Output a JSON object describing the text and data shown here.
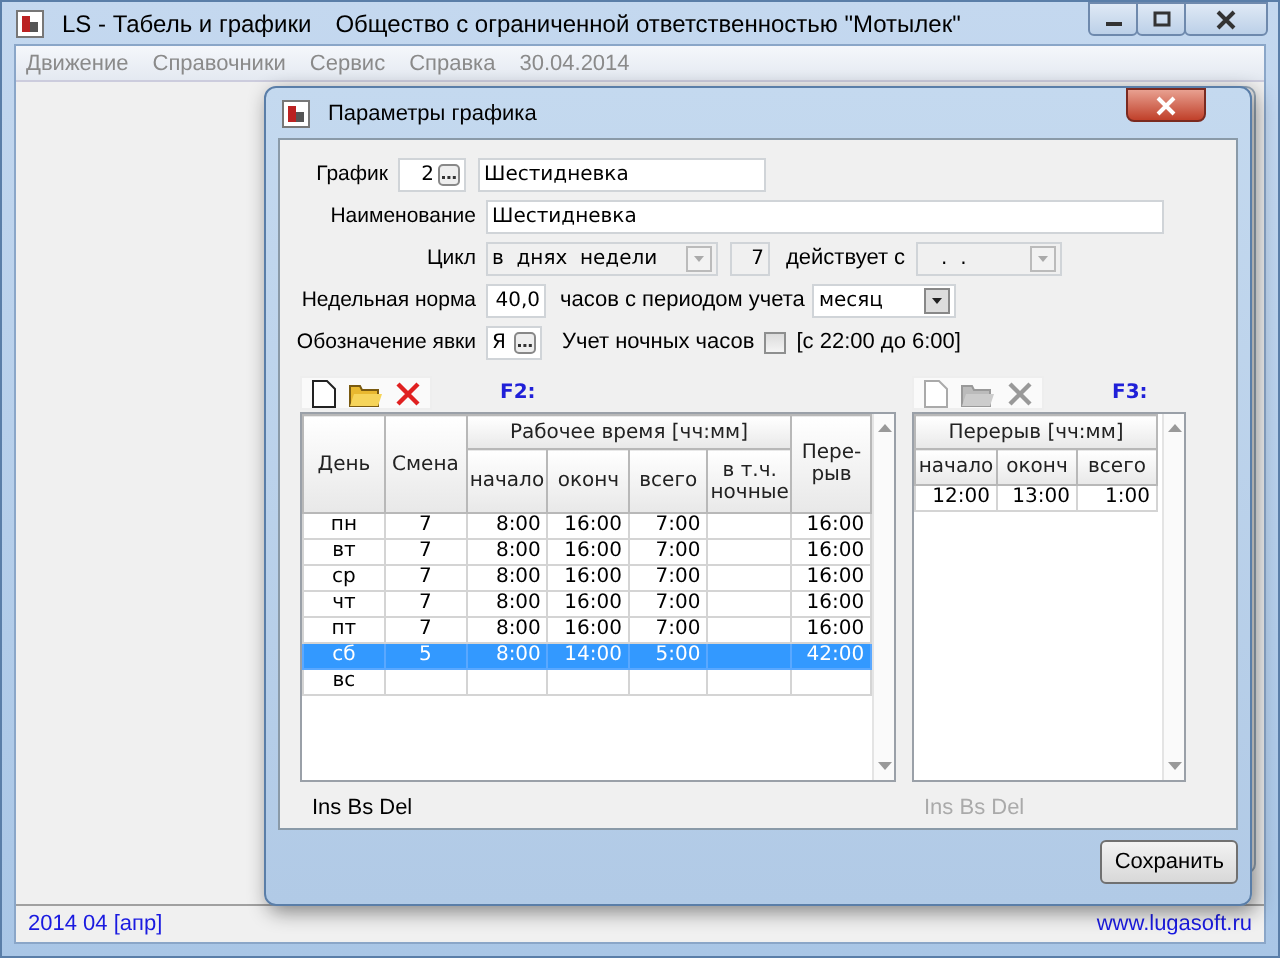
{
  "window": {
    "title": "LS - Табель и графики",
    "company": "Общество с ограниченной ответственностью \"Мотылек\""
  },
  "menu": [
    {
      "label": "Движение",
      "disabled": true
    },
    {
      "label": "Справочники",
      "disabled": true
    },
    {
      "label": "Сервис",
      "disabled": true
    },
    {
      "label": "Справка",
      "disabled": true
    },
    {
      "label": "30.04.2014",
      "disabled": true
    }
  ],
  "dialog": {
    "title": "Параметры графика",
    "schedule": {
      "label": "График",
      "number": "2",
      "name": "Шестидневка"
    },
    "name_field": {
      "label": "Наименование",
      "value": "Шестидневка"
    },
    "cycle": {
      "label": "Цикл",
      "type": "в  днях  недели",
      "type_disabled": true,
      "length": "7",
      "effective_label": "действует с",
      "effective_value": ".  .",
      "effective_disabled": true
    },
    "norm": {
      "label": "Недельная норма",
      "value": "40,0",
      "period_label": "часов с периодом учета",
      "period": "месяц",
      "period_disabled": false
    },
    "attendance": {
      "label": "Обозначение явки",
      "value": "Я",
      "night_label": "Учет ночных часов",
      "night_checked": false,
      "night_range": "[с 22:00 до 6:00]"
    },
    "work_table": {
      "toolbar_enabled": true,
      "hotkey": "F2:",
      "header": {
        "day": "День",
        "shift": "Смена",
        "work_time": "Рабочее время [чч:мм]",
        "start": "начало",
        "end": "оконч",
        "total": "всего",
        "night": "в т.ч. ночные",
        "break": "Пере-рыв"
      },
      "rows": [
        {
          "day": "пн",
          "shift": "7",
          "start": "8:00",
          "end": "16:00",
          "total": "7:00",
          "break": "16:00",
          "selected": false
        },
        {
          "day": "вт",
          "shift": "7",
          "start": "8:00",
          "end": "16:00",
          "total": "7:00",
          "break": "16:00",
          "selected": false
        },
        {
          "day": "ср",
          "shift": "7",
          "start": "8:00",
          "end": "16:00",
          "total": "7:00",
          "break": "16:00",
          "selected": false
        },
        {
          "day": "чт",
          "shift": "7",
          "start": "8:00",
          "end": "16:00",
          "total": "7:00",
          "break": "16:00",
          "selected": false
        },
        {
          "day": "пт",
          "shift": "7",
          "start": "8:00",
          "end": "16:00",
          "total": "7:00",
          "break": "16:00",
          "selected": false
        },
        {
          "day": "сб",
          "shift": "5",
          "start": "8:00",
          "end": "14:00",
          "total": "5:00",
          "break": "42:00",
          "selected": true
        },
        {
          "day": "вс",
          "selected": false
        }
      ],
      "keys": "Ins Bs Del",
      "keys_disabled": false
    },
    "break_table": {
      "toolbar_enabled": false,
      "hotkey": "F3:",
      "header": {
        "title": "Перерыв [чч:мм]",
        "start": "начало",
        "end": "оконч",
        "total": "всего"
      },
      "rows": [
        {
          "start": "12:00",
          "end": "13:00",
          "total": "1:00",
          "selected": false
        }
      ],
      "keys": "Ins Bs Del",
      "keys_disabled": true
    },
    "save_button": "Сохранить"
  },
  "status_bar": {
    "period": "2014 04 [апр]",
    "site": "www.lugasoft.ru"
  }
}
